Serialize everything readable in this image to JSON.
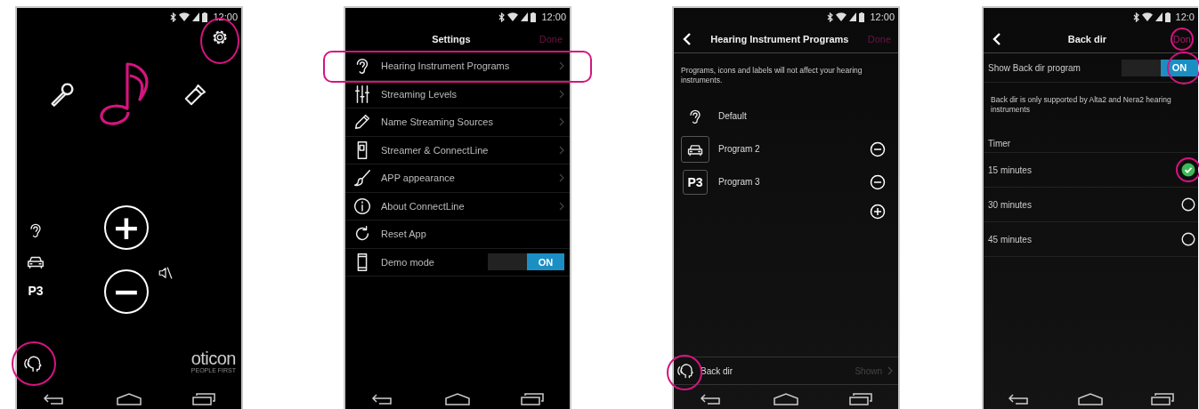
{
  "screens": [
    {
      "kind": "home",
      "time": "12:00",
      "settings_highlighted": true,
      "program_badge": "P3",
      "volume_up": "+",
      "volume_down": "−",
      "back_dir_highlighted": true,
      "logo": "oticon",
      "logo_tagline": "PEOPLE FIRST"
    },
    {
      "kind": "settings",
      "time": "12:00",
      "title": "Settings",
      "done": "Done",
      "items": [
        {
          "label": "Hearing Instrument Programs",
          "kind": "link",
          "highlighted": true
        },
        {
          "label": "Streaming Levels",
          "kind": "link",
          "highlighted": false
        },
        {
          "label": "Name Streaming Sources",
          "kind": "link",
          "highlighted": false
        },
        {
          "label": "Streamer & ConnectLine",
          "kind": "link",
          "highlighted": false
        },
        {
          "label": "APP appearance",
          "kind": "link",
          "highlighted": false
        },
        {
          "label": "About ConnectLine",
          "kind": "link",
          "highlighted": false
        },
        {
          "label": "Reset App",
          "kind": "action",
          "highlighted": false
        },
        {
          "label": "Demo mode",
          "kind": "toggle",
          "highlighted": false,
          "on": true,
          "state_label": "ON"
        }
      ]
    },
    {
      "kind": "programs",
      "time": "12:00",
      "title": "Hearing Instrument Programs",
      "done": "Done",
      "note": "Programs, icons and labels will not affect your hearing instruments.",
      "programs": [
        {
          "name": "Default",
          "removable": false
        },
        {
          "name": "Program 2",
          "removable": true
        },
        {
          "name": "Program 3",
          "badge": "P3",
          "removable": true
        }
      ],
      "footer": {
        "label": "Back dir",
        "value": "Shown",
        "highlighted": true
      }
    },
    {
      "kind": "backdir",
      "time": "12:0",
      "title": "Back dir",
      "done": "Don",
      "done_highlighted": true,
      "show_label": "Show Back dir program",
      "toggle": {
        "on": true,
        "state_label": "ON",
        "highlighted": true
      },
      "note": "Back dir is only supported by Alta2 and Nera2 hearing instruments",
      "timer_label": "Timer",
      "options": [
        {
          "label": "15 minutes",
          "selected": true,
          "highlighted": true
        },
        {
          "label": "30 minutes",
          "selected": false,
          "highlighted": false
        },
        {
          "label": "45 minutes",
          "selected": false,
          "highlighted": false
        }
      ]
    }
  ]
}
